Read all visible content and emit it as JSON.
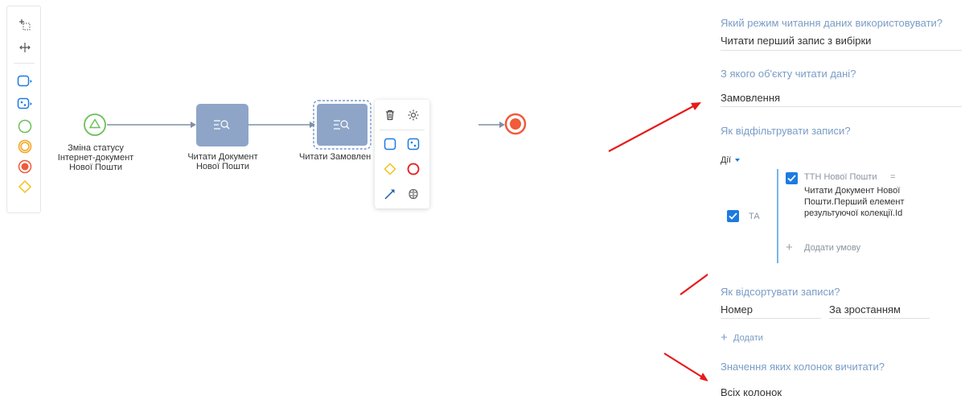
{
  "canvas": {
    "start_event_label": "Зміна статусу\nІнтернет-документ\nНової Пошти",
    "task1_label": "Читати Документ\nНової Пошти",
    "task2_label": "Читати Замовлен"
  },
  "toolbar": {
    "tools": [
      "lasso-select",
      "move",
      "user-task",
      "script-task",
      "start-event",
      "intermediate-event",
      "end-event",
      "gateway"
    ]
  },
  "panel": {
    "read_mode_question": "Який режим читання даних використовувати?",
    "read_mode_value": "Читати перший запис з вибірки",
    "object_question": "З якого об'єкту читати дані?",
    "object_value": "Замовлення",
    "filter_question": "Як відфільтрувати записи?",
    "actions_label": "Дії",
    "group_operator": "ТА",
    "condition_field": "ТТН Нової Пошти",
    "condition_operator": "=",
    "condition_value": "Читати Документ Нової Пошти.Перший елемент результуючої колекції.Id",
    "add_condition_label": "Додати умову",
    "sort_question": "Як відсортувати записи?",
    "sort_column": "Номер",
    "sort_direction": "За зростанням",
    "add_sort_label": "Додати",
    "columns_question": "Значення яких колонок вичитати?",
    "columns_value": "Всіх колонок"
  },
  "colors": {
    "task_fill": "#8ea5c8",
    "start_event": "#6bbf59",
    "end_event": "#f15a3a",
    "accent": "#1d7ae0",
    "annotation": "#e8191b"
  }
}
